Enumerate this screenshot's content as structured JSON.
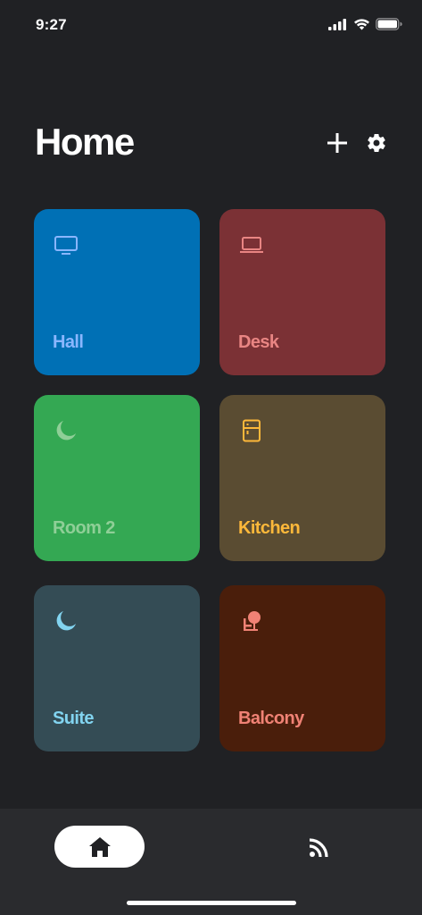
{
  "status_bar": {
    "time": "9:27"
  },
  "header": {
    "title": "Home"
  },
  "tiles": [
    {
      "label": "Hall",
      "icon": "tv-icon",
      "bg": "#0070b5",
      "fg": "#8ab6ff"
    },
    {
      "label": "Desk",
      "icon": "laptop-icon",
      "bg": "#7b3135",
      "fg": "#e98583"
    },
    {
      "label": "Room 2",
      "icon": "moon-icon",
      "bg": "#34a853",
      "fg": "#8fcf97"
    },
    {
      "label": "Kitchen",
      "icon": "fridge-icon",
      "bg": "#5a4c32",
      "fg": "#fdb83a"
    },
    {
      "label": "Suite",
      "icon": "moon-icon",
      "bg": "#344c55",
      "fg": "#82d4f0"
    },
    {
      "label": "Balcony",
      "icon": "outdoor-icon",
      "bg": "#4a1e0b",
      "fg": "#f08275"
    }
  ],
  "nav": {
    "items": [
      {
        "name": "home",
        "icon": "home-icon",
        "selected": true
      },
      {
        "name": "feed",
        "icon": "feed-icon",
        "selected": false
      }
    ]
  }
}
